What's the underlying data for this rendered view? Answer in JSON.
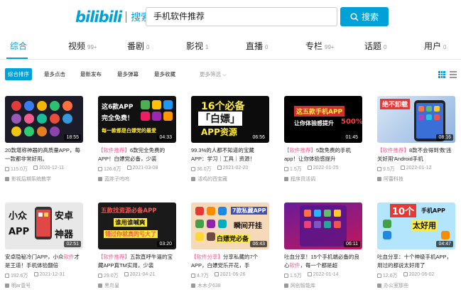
{
  "header": {
    "logo": "bilibili",
    "logo_suffix": "搜索",
    "search_value": "手机软件推荐",
    "search_button": "搜索"
  },
  "tabs": [
    {
      "label": "综合",
      "count": ""
    },
    {
      "label": "视频",
      "count": "99+"
    },
    {
      "label": "番剧",
      "count": "0"
    },
    {
      "label": "影视",
      "count": "1"
    },
    {
      "label": "直播",
      "count": "0"
    },
    {
      "label": "专栏",
      "count": "99+"
    },
    {
      "label": "话题",
      "count": "0"
    },
    {
      "label": "用户",
      "count": "0"
    }
  ],
  "filters": {
    "items": [
      "综合排序",
      "最多点击",
      "最新发布",
      "最多弹幕",
      "最多收藏"
    ],
    "more": "更多筛选"
  },
  "videos": [
    {
      "duration": "18:55",
      "title_pre": "20款堪称神器的高质量APP，每一款都非常好用。",
      "title_hl": "",
      "title_post": "",
      "views": "115.0万",
      "date": "2020-12-11",
      "uploader": "影视后期系统教学"
    },
    {
      "duration": "04:33",
      "title_pre": "",
      "title_hl": "【软件推荐】",
      "title_post": "6款完全免费的APP！白嫖党必备，少装",
      "views": "126.6万",
      "date": "2021-03-08",
      "uploader": "蓝胖子呜呜"
    },
    {
      "duration": "06:56",
      "title_pre": "99.3%的人都不知道的宝藏APP：学习｜工具｜资源！",
      "title_hl": "",
      "title_post": "",
      "views": "36.0万",
      "date": "2021-02-20",
      "uploader": "活鸡的西宝藏"
    },
    {
      "duration": "01:45",
      "title_pre": "",
      "title_hl": "【软件推荐】",
      "title_post": "5款免费的手机app！让你体验感提升",
      "views": "1.5万",
      "date": "2022-01-25",
      "uploader": "程序员活调"
    },
    {
      "duration": "08:16",
      "title_pre": "",
      "title_hl": "【软件推荐】",
      "title_post": "8款不会得到'数'违关好用'Android手机",
      "views": "9.5万",
      "date": "2022-01-12",
      "uploader": "阿蕾科技"
    },
    {
      "duration": "02:51",
      "title_pre": "安卓隐秘冷门APP，小众",
      "title_hl": "软件",
      "title_post": "才是王道！手机体验翻倍",
      "views": "192.6万",
      "date": "2021-12-31",
      "uploader": "明ar壹号"
    },
    {
      "duration": "03:20",
      "title_pre": "",
      "title_hl": "【软件推荐】",
      "title_post": "五款直呼牛逼的宝藏APP真TM实用，少装",
      "views": "29.0万",
      "date": "2021-04-21",
      "uploader": "黑鸟皇"
    },
    {
      "duration": "06:43",
      "title_pre": "",
      "title_hl": "【软件分享】",
      "title_post": "分享私藏的7个APP，白嫖党乐开花，手",
      "views": "4.7万",
      "date": "2021-06-26",
      "uploader": "木木夕638"
    },
    {
      "duration": "06:11",
      "title_pre": "吐血分享！15个手机端必备的良心",
      "title_hl": "软件",
      "title_post": "，每一个都是超",
      "views": "1.5万",
      "date": "2022-01-14",
      "uploader": "网创智能库"
    },
    {
      "duration": "04:47",
      "title_pre": "吐血分享：十个神级手机APP，用过的都说太好用了",
      "title_hl": "",
      "title_post": "",
      "views": "12.6万",
      "date": "2020-06-02",
      "uploader": "办公室那些"
    }
  ],
  "thumb_text": {
    "t2_line1": "这6款APP",
    "t2_line2": "完全免费！",
    "t2_line3": "每一款都是白嫖党的最爱",
    "t3_line1": "16个必备",
    "t3_line2": "「白嫖」",
    "t3_line3": "APP资源",
    "t4_line1": "这五款手机APP",
    "t4_line2": "让你体验感提升",
    "t4_line3": "500%",
    "t5_line1": "绝不卸载",
    "t6_line1": "小众",
    "t6_line2": "安卓",
    "t6_line3": "APP",
    "t6_line4": "神器",
    "t7_line1": "五款找资源必备APP",
    "t7_line2": "谁用谁喊爽",
    "t7_line3": "错过你就真的亏大了",
    "t8_line1": "7款私藏APP",
    "t8_line2": "瞬间开挂",
    "t8_line3": "白嫖党必备",
    "t10_line1": "10个",
    "t10_line2": "手机APP",
    "t10_line3": "太好用"
  },
  "colors": {
    "accent": "#00a1d6",
    "highlight": "#f25d8e"
  }
}
